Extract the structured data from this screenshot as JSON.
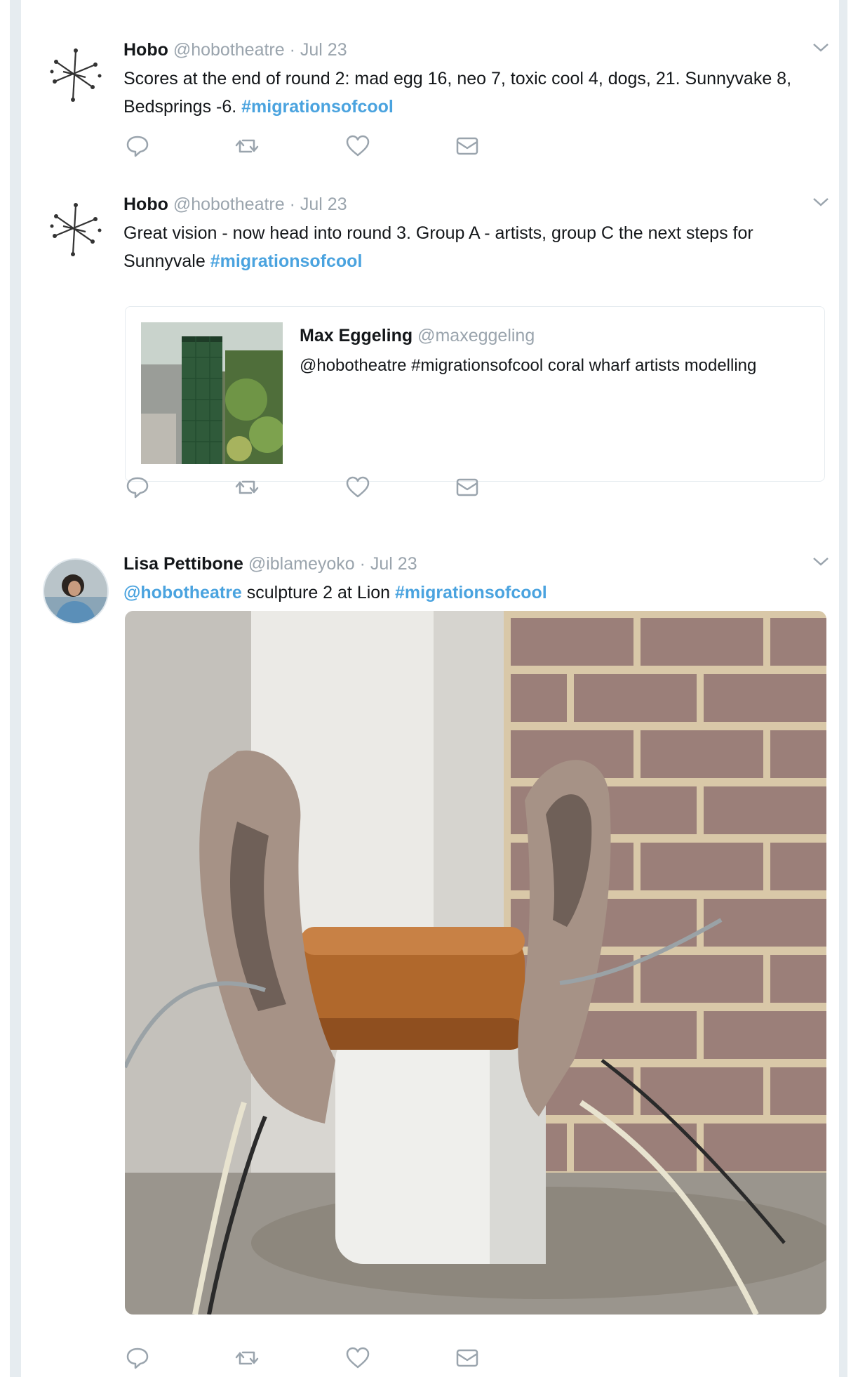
{
  "tweets": [
    {
      "name": "Hobo",
      "handle": "@hobotheatre",
      "separator": "·",
      "time": "Jul 23",
      "text": "Scores at the end of round 2: mad egg 16, neo 7, toxic cool 4, dogs, 21. Sunnyvake 8, Bedsprings -6.",
      "hashtag": "#migrationsofcool"
    },
    {
      "name": "Hobo",
      "handle": "@hobotheatre",
      "separator": "·",
      "time": "Jul 23",
      "text": "Great vision - now head into round 3. Group A - artists, group C the next steps for Sunnyvale",
      "hashtag": "#migrationsofcool",
      "quote": {
        "name": "Max Eggeling",
        "handle": "@maxeggeling",
        "text": "@hobotheatre #migrationsofcool coral wharf artists modelling"
      }
    },
    {
      "name": "Lisa Pettibone",
      "handle": "@iblameyoko",
      "separator": "·",
      "time": "Jul 23",
      "mention": "@hobotheatre",
      "text": "sculpture 2 at Lion",
      "hashtag": "#migrationsofcool"
    }
  ],
  "icons": {
    "reply": "reply-icon",
    "retweet": "retweet-icon",
    "like": "heart-icon",
    "dm": "envelope-icon",
    "caret": "chevron-down-icon"
  },
  "colors": {
    "link": "#4aa3df",
    "muted": "#9aa4ad",
    "border": "#e6ecf0",
    "text": "#14171a"
  }
}
